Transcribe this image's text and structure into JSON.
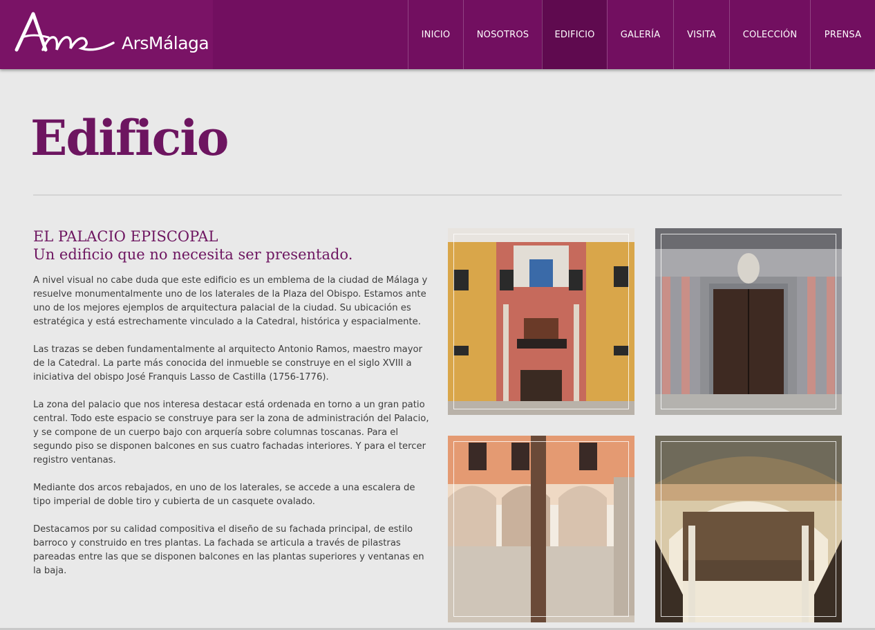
{
  "brand": {
    "name": "ArsMálaga",
    "logo_letters": "Am",
    "colors": {
      "primary": "#720f60",
      "accent": "#6d1560"
    }
  },
  "nav": {
    "items": [
      {
        "label": "INICIO"
      },
      {
        "label": "NOSOTROS"
      },
      {
        "label": "EDIFICIO",
        "active": true
      },
      {
        "label": "GALERÍA"
      },
      {
        "label": "VISITA"
      },
      {
        "label": "COLECCIÓN"
      },
      {
        "label": "PRENSA"
      }
    ]
  },
  "page": {
    "title": "Edificio"
  },
  "section": {
    "heading": "EL PALACIO EPISCOPAL",
    "subheading": "Un edificio que no necesita ser presentado.",
    "paragraphs": [
      "A nivel visual no cabe duda que este edificio es un emblema de la ciudad de Málaga y resuelve monumentalmente uno de los laterales de la Plaza del Obispo. Estamos ante uno de los mejores ejemplos de arquitectura palacial de la ciudad. Su ubicación es estratégica y está estrechamente vinculado a la Catedral, histórica y espacialmente.",
      "Las trazas se deben fundamentalmente al arquitecto Antonio Ramos, maestro mayor de la Catedral. La parte más conocida del inmueble se construye en el siglo XVIII a iniciativa del obispo José Franquis Lasso de Castilla (1756-1776).",
      "La zona del palacio que nos interesa destacar está ordenada en torno a un gran patio central. Todo este espacio se construye para ser la zona de administración del Palacio, y se compone de un cuerpo bajo con arquería sobre columnas toscanas. Para el segundo piso se disponen balcones en sus cuatro fachadas interiores. Y para el tercer registro ventanas.",
      "Mediante dos arcos rebajados, en uno de los laterales, se accede a una escalera de tipo imperial de doble tiro y cubierta de un casquete ovalado.",
      "Destacamos por su calidad compositiva el diseño de su fachada principal, de estilo barroco y construido en tres plantas. La fachada se articula a través de pilastras pareadas entre las que se disponen balcones en las plantas superiores y ventanas en la baja."
    ]
  },
  "gallery": [
    {
      "icon": "facade-photo"
    },
    {
      "icon": "doorway-photo"
    },
    {
      "icon": "courtyard-photo"
    },
    {
      "icon": "staircase-arch-photo"
    }
  ]
}
